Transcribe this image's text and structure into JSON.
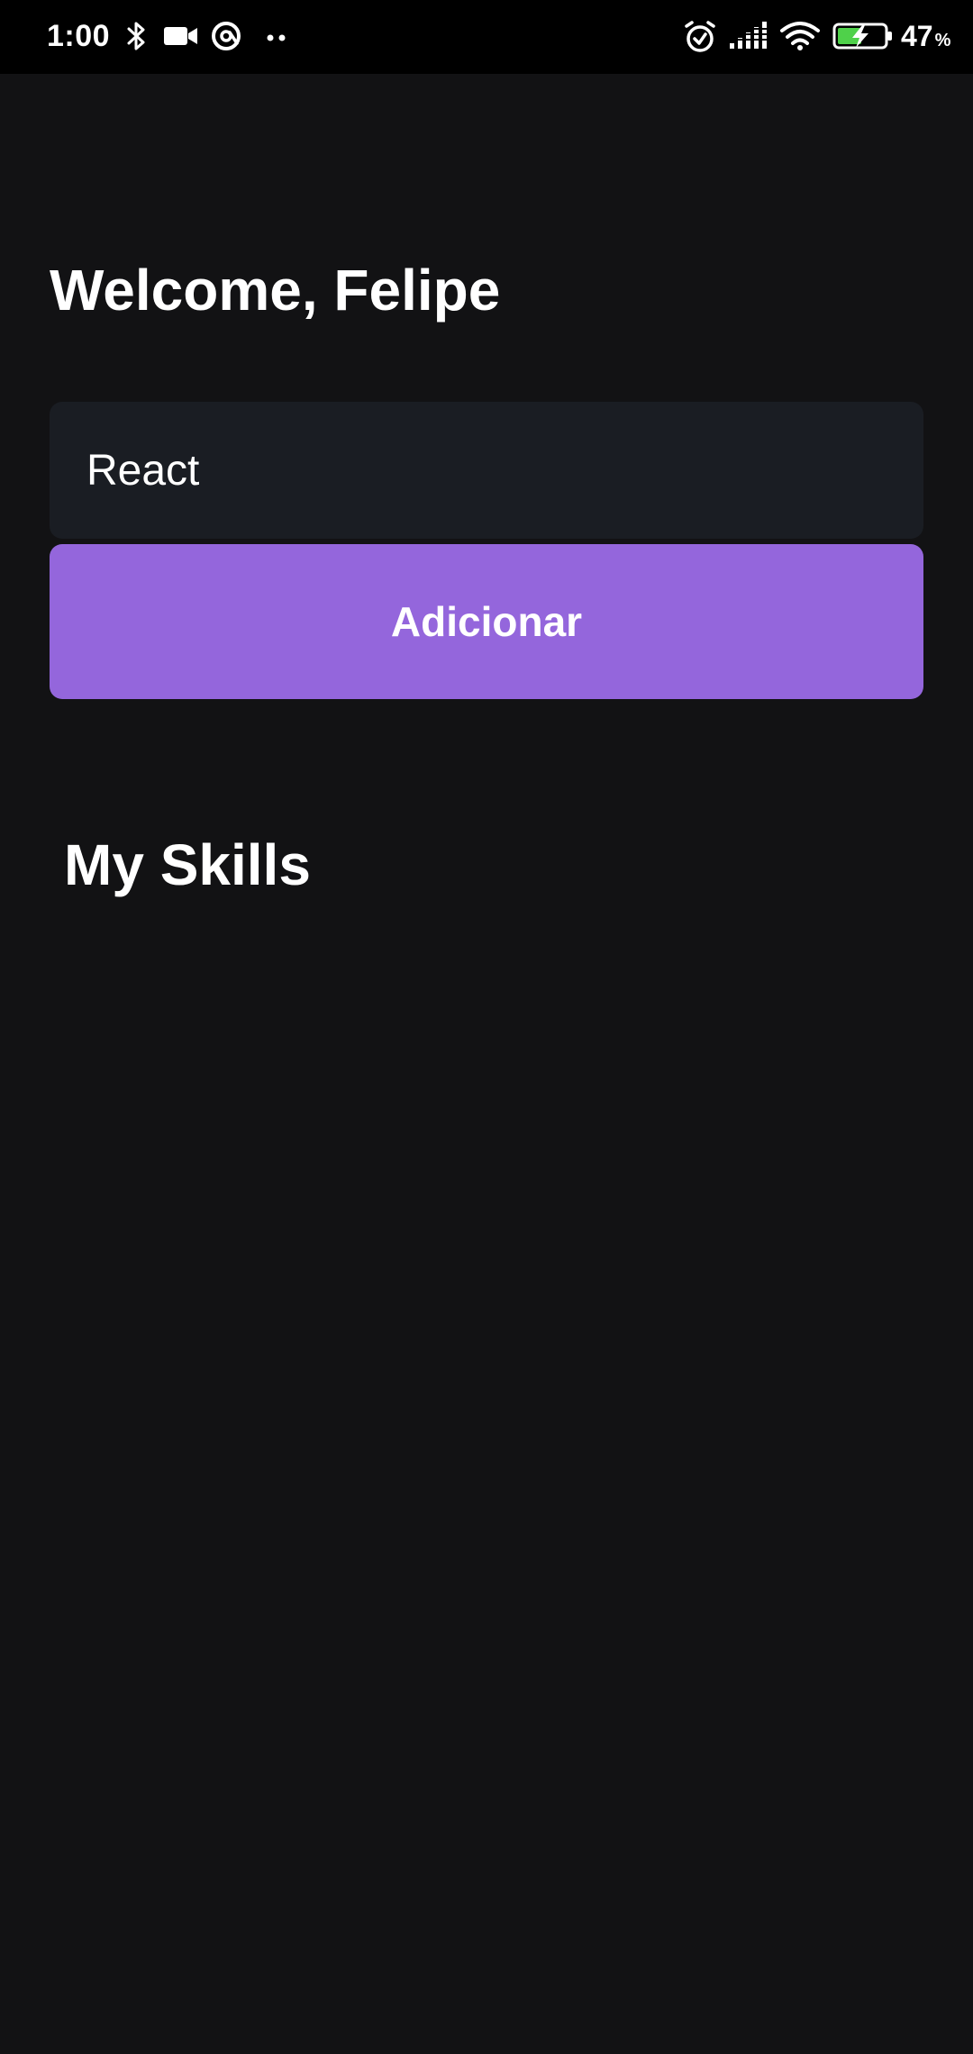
{
  "status_bar": {
    "time": "1:00",
    "battery_level": "47",
    "battery_unit": "%",
    "icons": [
      "bluetooth-icon",
      "video-camera-icon",
      "at-sign-icon",
      "more-dots-icon",
      "alarm-icon",
      "signal-icon",
      "wifi-icon",
      "battery-charging-icon"
    ]
  },
  "header": {
    "welcome_text": "Welcome, Felipe"
  },
  "form": {
    "input_value": "React",
    "button_label": "Adicionar"
  },
  "skills": {
    "title": "My Skills",
    "items": []
  },
  "colors": {
    "background": "#121214",
    "input_background": "#1a1d23",
    "accent": "#9466dc",
    "text": "#ffffff",
    "battery_green": "#4fd14a"
  }
}
